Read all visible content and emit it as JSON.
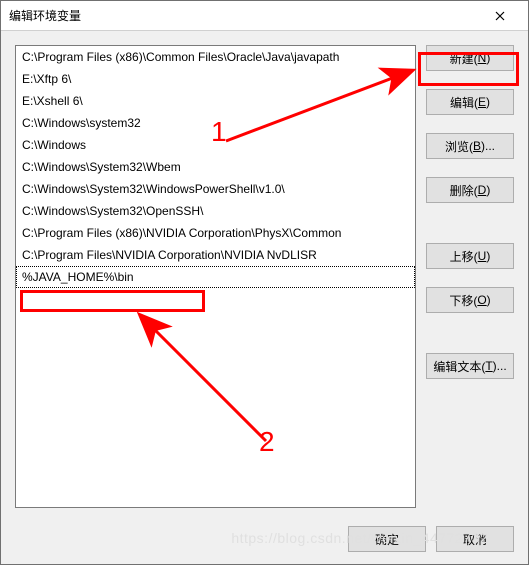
{
  "titlebar": {
    "title": "编辑环境变量"
  },
  "list": {
    "items": [
      "C:\\Program Files (x86)\\Common Files\\Oracle\\Java\\javapath",
      "E:\\Xftp 6\\",
      "E:\\Xshell 6\\",
      "C:\\Windows\\system32",
      "C:\\Windows",
      "C:\\Windows\\System32\\Wbem",
      "C:\\Windows\\System32\\WindowsPowerShell\\v1.0\\",
      "C:\\Windows\\System32\\OpenSSH\\",
      "C:\\Program Files (x86)\\NVIDIA Corporation\\PhysX\\Common",
      "C:\\Program Files\\NVIDIA Corporation\\NVIDIA NvDLISR",
      "%JAVA_HOME%\\bin"
    ]
  },
  "buttons": {
    "new": "新建(N)",
    "edit": "编辑(E)",
    "browse": "浏览(B)...",
    "delete": "删除(D)",
    "moveup": "上移(U)",
    "movedown": "下移(O)",
    "edittext": "编辑文本(T)...",
    "ok": "确定",
    "cancel": "取消"
  },
  "annotations": {
    "num1": "1",
    "num2": "2"
  },
  "watermark": "https://blog.csdn.net/weixin_44772732"
}
